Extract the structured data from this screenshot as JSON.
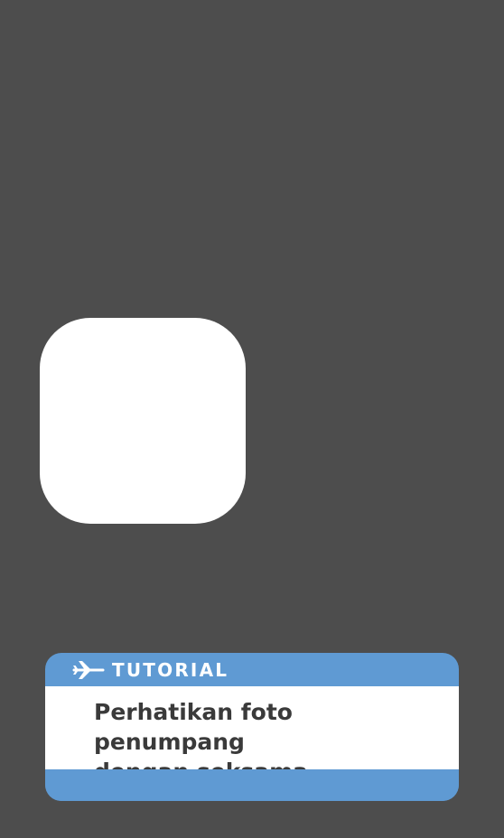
{
  "tutorial": {
    "icon": "airplane-icon",
    "title": "TUTORIAL",
    "message": "Perhatikan foto penumpang\ndengan seksama."
  },
  "colors": {
    "background": "#4d4d4d",
    "card_accent": "#5f9ad3",
    "card_body": "#ffffff",
    "body_text": "#3a3a3a"
  }
}
